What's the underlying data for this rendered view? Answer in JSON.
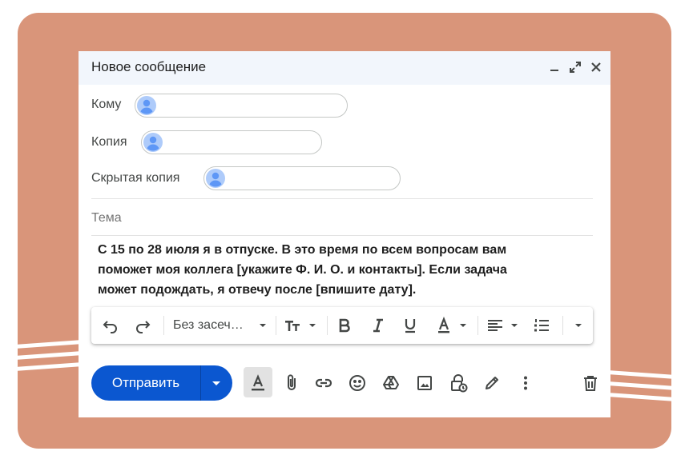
{
  "window": {
    "title": "Новое сообщение",
    "icons": [
      "minimize-icon",
      "expand-icon",
      "close-icon"
    ]
  },
  "fields": {
    "to_label": "Кому",
    "cc_label": "Копия",
    "bcc_label": "Скрытая копия",
    "subject_placeholder": "Тема"
  },
  "body": {
    "line1": "С 15 по 28 июля я в отпуске. В это время по всем вопросам вам",
    "line2": "поможет моя коллега [укажите Ф. И. О. и контакты]. Если задача",
    "line3": "может подождать, я отвечу после [впишите дату]."
  },
  "toolbar": {
    "font_label": "Без засеч…"
  },
  "actions": {
    "send_label": "Отправить"
  },
  "colors": {
    "frame": "#d9957a",
    "accent": "#0b57d0",
    "avatar": "#5e97f6"
  }
}
